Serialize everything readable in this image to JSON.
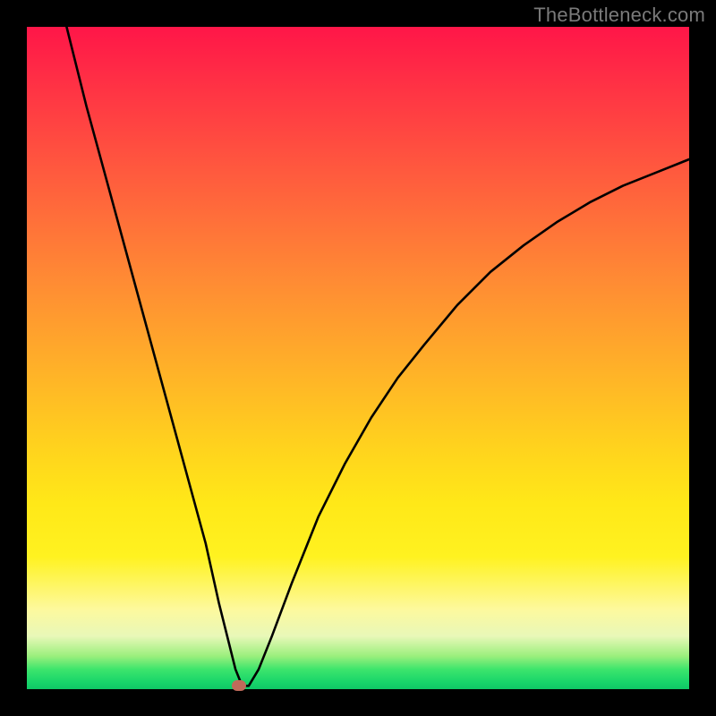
{
  "watermark": "TheBottleneck.com",
  "chart_data": {
    "type": "line",
    "title": "",
    "xlabel": "",
    "ylabel": "",
    "xlim": [
      0,
      100
    ],
    "ylim": [
      0,
      100
    ],
    "grid": false,
    "series": [
      {
        "name": "curve",
        "x": [
          6,
          9,
          12,
          15,
          18,
          21,
          24,
          27,
          29,
          30.5,
          31.5,
          32.5,
          33.5,
          35,
          37,
          40,
          44,
          48,
          52,
          56,
          60,
          65,
          70,
          75,
          80,
          85,
          90,
          95,
          100
        ],
        "y": [
          100,
          88,
          77,
          66,
          55,
          44,
          33,
          22,
          13,
          7,
          3,
          0.5,
          0.5,
          3,
          8,
          16,
          26,
          34,
          41,
          47,
          52,
          58,
          63,
          67,
          70.5,
          73.5,
          76,
          78,
          80
        ]
      }
    ],
    "marker": {
      "x": 32,
      "y": 0.5
    }
  },
  "colors": {
    "curve": "#000000",
    "marker": "#c06a5a",
    "background_top": "#ff1648",
    "background_bottom": "#0fc766"
  }
}
